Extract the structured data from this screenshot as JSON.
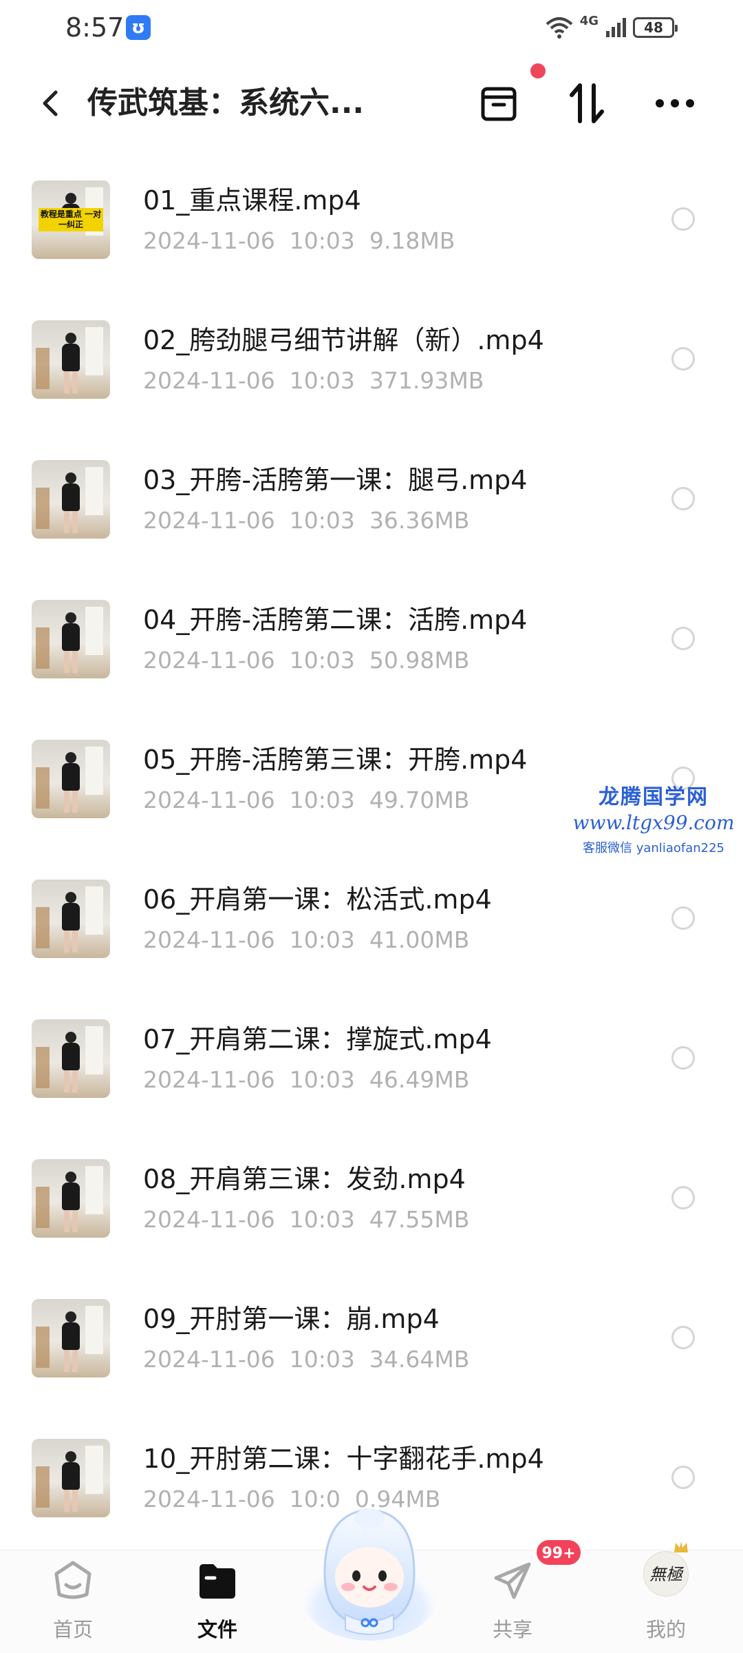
{
  "status_bar": {
    "time": "8:57",
    "app_badge": "ʊ",
    "network": "4G",
    "battery": "48"
  },
  "header": {
    "title": "传武筑基：系统六...",
    "back_icon": "chevron-left-icon",
    "actions": [
      "archive-icon",
      "sort-icon",
      "more-icon"
    ]
  },
  "files": [
    {
      "name": "01_重点课程.mp4",
      "date": "2024-11-06",
      "time": "10:03",
      "size": "9.18MB",
      "thumb_caption": "教程是重点 一对一纠正"
    },
    {
      "name": "02_胯劲腿弓细节讲解（新）.mp4",
      "date": "2024-11-06",
      "time": "10:03",
      "size": "371.93MB"
    },
    {
      "name": "03_开胯-活胯第一课：腿弓.mp4",
      "date": "2024-11-06",
      "time": "10:03",
      "size": "36.36MB"
    },
    {
      "name": "04_开胯-活胯第二课：活胯.mp4",
      "date": "2024-11-06",
      "time": "10:03",
      "size": "50.98MB"
    },
    {
      "name": "05_开胯-活胯第三课：开胯.mp4",
      "date": "2024-11-06",
      "time": "10:03",
      "size": "49.70MB"
    },
    {
      "name": "06_开肩第一课：松活式.mp4",
      "date": "2024-11-06",
      "time": "10:03",
      "size": "41.00MB"
    },
    {
      "name": "07_开肩第二课：撑旋式.mp4",
      "date": "2024-11-06",
      "time": "10:03",
      "size": "46.49MB"
    },
    {
      "name": "08_开肩第三课：发劲.mp4",
      "date": "2024-11-06",
      "time": "10:03",
      "size": "47.55MB"
    },
    {
      "name": "09_开肘第一课：崩.mp4",
      "date": "2024-11-06",
      "time": "10:03",
      "size": "34.64MB"
    },
    {
      "name": "10_开肘第二课：十字翻花手.mp4",
      "date": "2024-11-06",
      "time": "10:0",
      "size": "0.94MB"
    }
  ],
  "watermark": {
    "line1": "龙腾国学网",
    "line2": "www.ltgx99.com",
    "line3": "客服微信 yanliaofan225"
  },
  "bottom_nav": {
    "items": [
      {
        "label": "首页",
        "icon": "home-icon"
      },
      {
        "label": "文件",
        "icon": "folder-icon"
      },
      {
        "label": "共享",
        "icon": "send-icon"
      },
      {
        "label": "我的",
        "icon": "avatar-icon"
      }
    ],
    "share_badge": "99+",
    "avatar_text": "無極"
  },
  "colors": {
    "accent_red": "#f0465a",
    "meta_gray": "#b1b1b1",
    "watermark_blue": "#2a5fd6"
  }
}
